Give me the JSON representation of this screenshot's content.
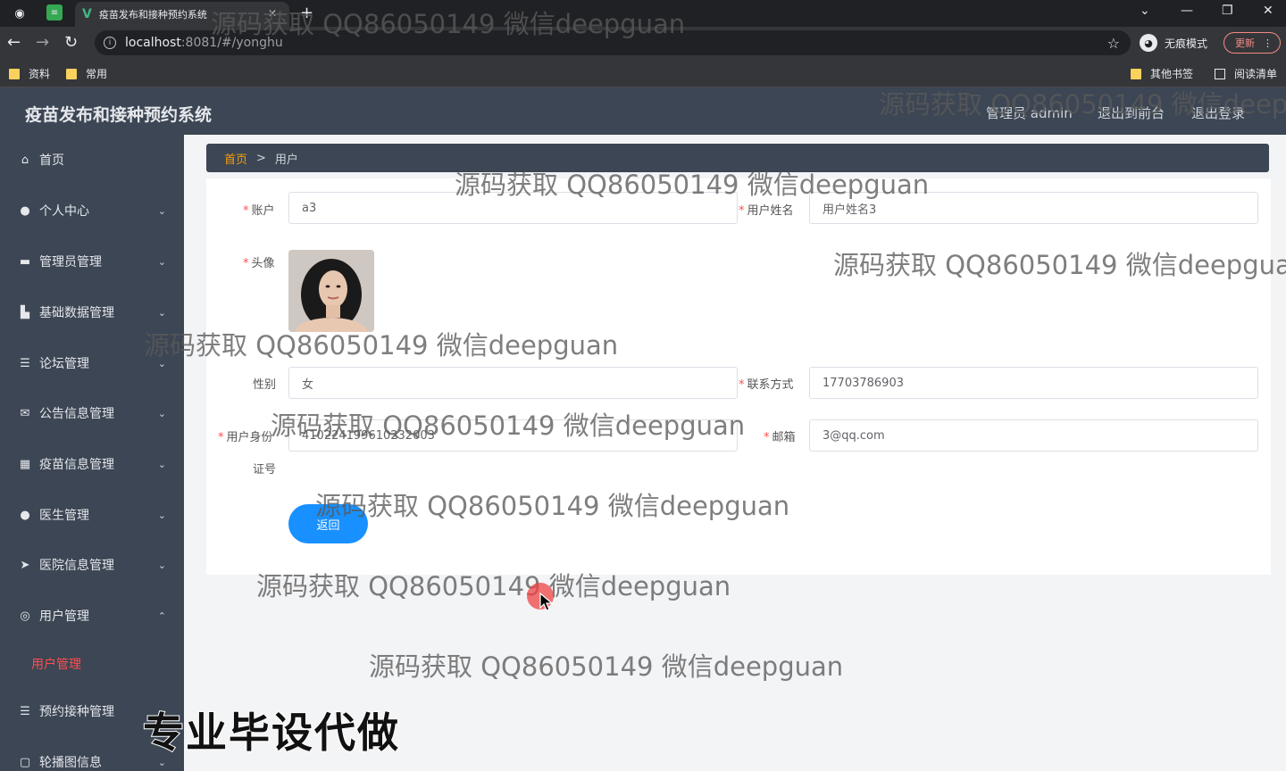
{
  "browser": {
    "tab_title": "疫苗发布和接种预约系统",
    "url_host": "localhost",
    "url_path": ":8081/#/yonghu",
    "incognito_label": "无痕模式",
    "update_label": "更新",
    "bookmarks": [
      {
        "label": "资料"
      },
      {
        "label": "常用"
      },
      {
        "label": "其他书签"
      },
      {
        "label": "阅读清单"
      }
    ]
  },
  "header": {
    "title": "疫苗发布和接种预约系统",
    "admin_label": "管理员 admin",
    "front_label": "退出到前台",
    "logout_label": "退出登录"
  },
  "sidebar": {
    "items": [
      {
        "label": "首页",
        "icon": "home-icon"
      },
      {
        "label": "个人中心",
        "icon": "user-icon"
      },
      {
        "label": "管理员管理",
        "icon": "admin-icon"
      },
      {
        "label": "基础数据管理",
        "icon": "data-icon"
      },
      {
        "label": "论坛管理",
        "icon": "list-icon"
      },
      {
        "label": "公告信息管理",
        "icon": "mail-icon"
      },
      {
        "label": "疫苗信息管理",
        "icon": "grid-icon"
      },
      {
        "label": "医生管理",
        "icon": "user-icon"
      },
      {
        "label": "医院信息管理",
        "icon": "send-icon"
      },
      {
        "label": "用户管理",
        "icon": "circle-icon"
      },
      {
        "label": "预约接种管理",
        "icon": "list-icon"
      },
      {
        "label": "轮播图信息",
        "icon": "picture-icon"
      }
    ],
    "active_sub": "用户管理"
  },
  "breadcrumb": {
    "home": "首页",
    "separator": ">",
    "current": "用户"
  },
  "form": {
    "account_label": "账户",
    "account_value": "a3",
    "name_label": "用户姓名",
    "name_value": "用户姓名3",
    "avatar_label": "头像",
    "gender_label": "性别",
    "gender_value": "女",
    "phone_label": "联系方式",
    "phone_value": "17703786903",
    "idcard_label": "用户身份",
    "idcard_label2": "证号",
    "idcard_value": "410224199610232003",
    "email_label": "邮箱",
    "email_value": "3@qq.com",
    "back_label": "返回"
  },
  "overlay": {
    "watermark": "源码获取 QQ86050149 微信deepguan",
    "banner": "专业毕设代做"
  }
}
